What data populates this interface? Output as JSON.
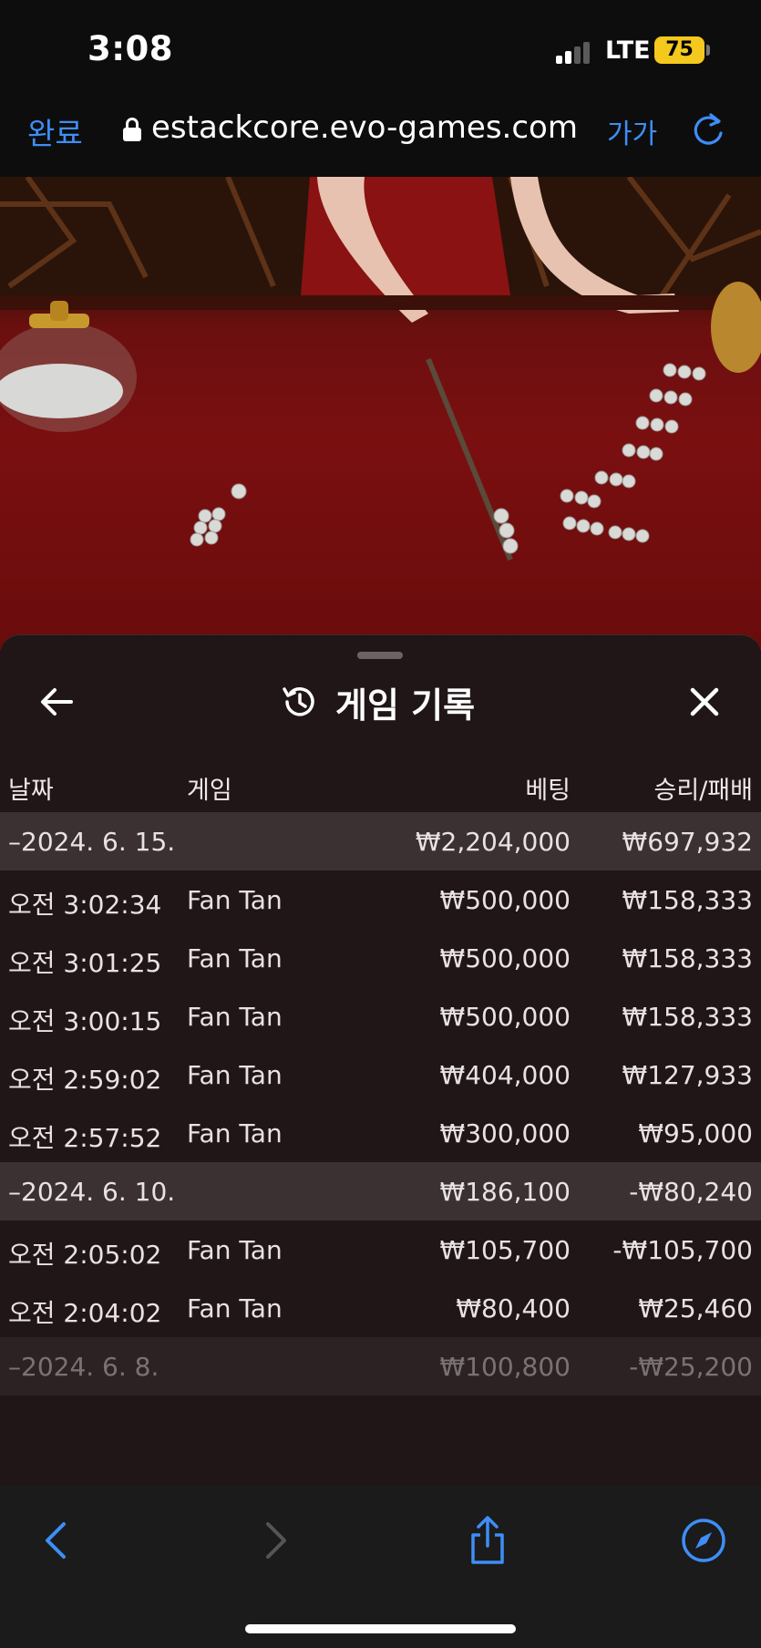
{
  "status_bar": {
    "time": "3:08",
    "network": "LTE",
    "battery": "75"
  },
  "url_bar": {
    "done_label": "완료",
    "url": "estackcore.evo-games.com",
    "text_size_label": "가가"
  },
  "sheet": {
    "title": "게임 기록",
    "headers": {
      "date": "날짜",
      "game": "게임",
      "bet": "베팅",
      "win_loss": "승리/패배"
    },
    "groups": [
      {
        "date": "–2024. 6. 15.",
        "bet": "₩2,204,000",
        "win_loss": "₩697,932",
        "rows": [
          {
            "time": "오전 3:02:34",
            "game": "Fan Tan",
            "bet": "₩500,000",
            "win_loss": "₩158,333"
          },
          {
            "time": "오전 3:01:25",
            "game": "Fan Tan",
            "bet": "₩500,000",
            "win_loss": "₩158,333"
          },
          {
            "time": "오전 3:00:15",
            "game": "Fan Tan",
            "bet": "₩500,000",
            "win_loss": "₩158,333"
          },
          {
            "time": "오전 2:59:02",
            "game": "Fan Tan",
            "bet": "₩404,000",
            "win_loss": "₩127,933"
          },
          {
            "time": "오전 2:57:52",
            "game": "Fan Tan",
            "bet": "₩300,000",
            "win_loss": "₩95,000"
          }
        ]
      },
      {
        "date": "–2024. 6. 10.",
        "bet": "₩186,100",
        "win_loss": "-₩80,240",
        "rows": [
          {
            "time": "오전 2:05:02",
            "game": "Fan Tan",
            "bet": "₩105,700",
            "win_loss": "-₩105,700"
          },
          {
            "time": "오전 2:04:02",
            "game": "Fan Tan",
            "bet": "₩80,400",
            "win_loss": "₩25,460"
          }
        ]
      },
      {
        "date": "–2024. 6. 8.",
        "bet": "₩100,800",
        "win_loss": "-₩25,200",
        "rows": []
      }
    ]
  },
  "colors": {
    "accent": "#3e8ef7",
    "sheet_bg": "#201617",
    "date_row_bg": "#3b3132",
    "battery": "#f4c81c"
  }
}
